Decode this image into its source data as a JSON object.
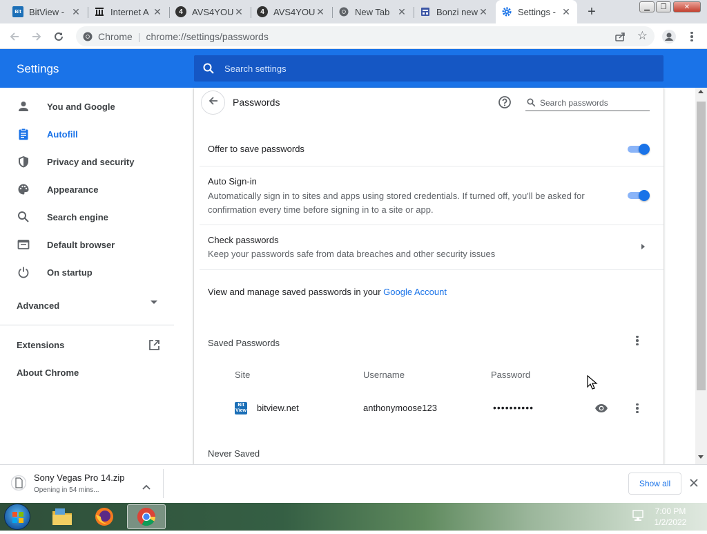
{
  "browser": {
    "tabs": [
      {
        "title": "BitView -",
        "favicon": "bitview-favicon"
      },
      {
        "title": "Internet A",
        "favicon": "archive-favicon"
      },
      {
        "title": "AVS4YOU",
        "favicon": "avs-favicon"
      },
      {
        "title": "AVS4YOU",
        "favicon": "avs-favicon"
      },
      {
        "title": "New Tab",
        "favicon": "chrome-favicon"
      },
      {
        "title": "Bonzi new",
        "favicon": "bonzi-favicon"
      },
      {
        "title": "Settings -",
        "favicon": "settings-favicon"
      }
    ],
    "omnibox": {
      "chip": "Chrome",
      "url": "chrome://settings/passwords"
    }
  },
  "header": {
    "title": "Settings",
    "search_placeholder": "Search settings"
  },
  "sidebar": {
    "items": [
      {
        "label": "You and Google",
        "icon": "person-icon"
      },
      {
        "label": "Autofill",
        "icon": "clipboard-icon"
      },
      {
        "label": "Privacy and security",
        "icon": "shield-icon"
      },
      {
        "label": "Appearance",
        "icon": "palette-icon"
      },
      {
        "label": "Search engine",
        "icon": "search-icon"
      },
      {
        "label": "Default browser",
        "icon": "browser-icon"
      },
      {
        "label": "On startup",
        "icon": "power-icon"
      }
    ],
    "advanced_label": "Advanced",
    "extensions_label": "Extensions",
    "about_label": "About Chrome"
  },
  "passwords": {
    "page_title": "Passwords",
    "search_placeholder": "Search passwords",
    "offer_to_save": {
      "label": "Offer to save passwords",
      "enabled": true
    },
    "auto_signin": {
      "label": "Auto Sign-in",
      "description": "Automatically sign in to sites and apps using stored credentials. If turned off, you'll be asked for confirmation every time before signing in to a site or app.",
      "enabled": true
    },
    "check_passwords": {
      "label": "Check passwords",
      "description": "Keep your passwords safe from data breaches and other security issues"
    },
    "manage_text": "View and manage saved passwords in your",
    "manage_link": "Google Account",
    "saved_heading": "Saved Passwords",
    "columns": {
      "site": "Site",
      "username": "Username",
      "password": "Password"
    },
    "entries": [
      {
        "site": "bitview.net",
        "username": "anthonymoose123",
        "password": "••••••••••"
      }
    ],
    "never_saved_heading": "Never Saved"
  },
  "download": {
    "filename": "Sony Vegas Pro 14.zip",
    "status": "Opening in 54 mins...",
    "show_all": "Show all"
  },
  "taskbar": {
    "time": "7:00 PM",
    "date": "1/2/2022"
  },
  "colors": {
    "accent": "#1a73e8",
    "header": "#1a73e8",
    "search_bg": "#1557c4"
  }
}
